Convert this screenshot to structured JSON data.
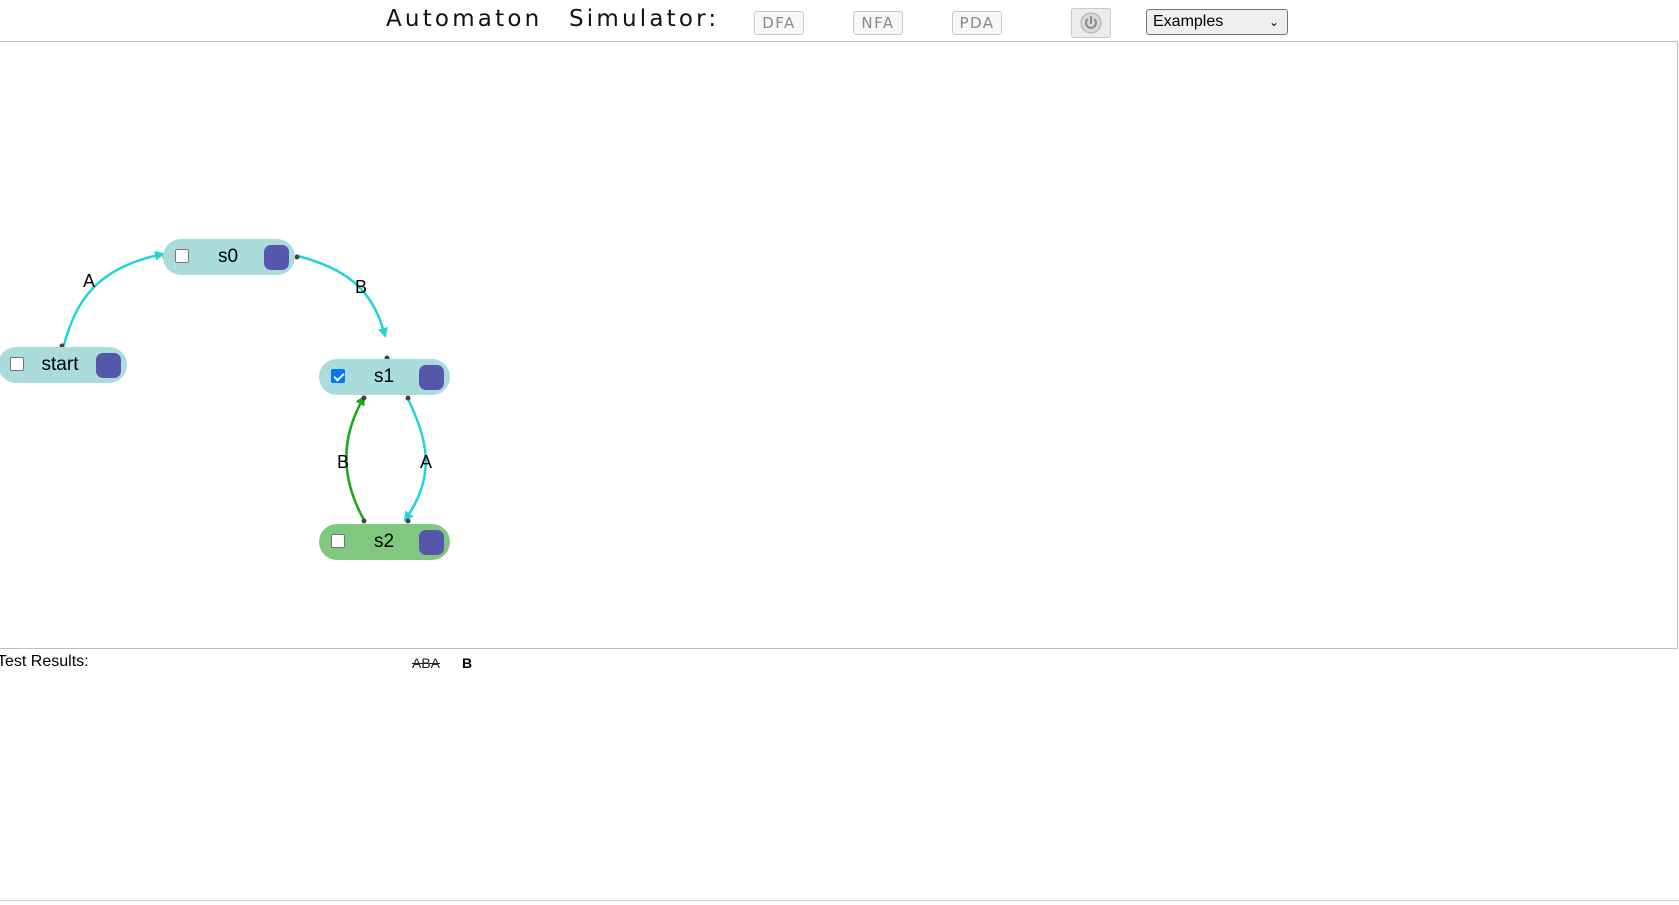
{
  "header": {
    "title_1": "Automaton",
    "title_2": "Simulator:",
    "modes": [
      "DFA",
      "NFA",
      "PDA"
    ],
    "examples_select": "Examples"
  },
  "states": [
    {
      "id": "start",
      "label": "start",
      "checked": false,
      "color": "#aadcdc"
    },
    {
      "id": "s0",
      "label": "s0",
      "checked": false,
      "color": "#aadcdc"
    },
    {
      "id": "s1",
      "label": "s1",
      "checked": true,
      "color": "#aadcdc"
    },
    {
      "id": "s2",
      "label": "s2",
      "checked": false,
      "color": "#80c880"
    }
  ],
  "transitions": [
    {
      "from": "start",
      "to": "s0",
      "symbol": "A",
      "color": "#22d3d8"
    },
    {
      "from": "s0",
      "to": "s1",
      "symbol": "B",
      "color": "#22d3d8"
    },
    {
      "from": "s1",
      "to": "s2",
      "symbol": "A",
      "color": "#22d3d8"
    },
    {
      "from": "s2",
      "to": "s1",
      "symbol": "B",
      "color": "#14a814"
    }
  ],
  "colors": {
    "state_handle": "#5656aa",
    "accept_state": "#80c880",
    "state": "#aadcdc"
  },
  "results": {
    "label": "Test Results:",
    "tests": [
      {
        "text": "ABA",
        "passed": false
      },
      {
        "text": "B",
        "passed": true
      }
    ]
  }
}
